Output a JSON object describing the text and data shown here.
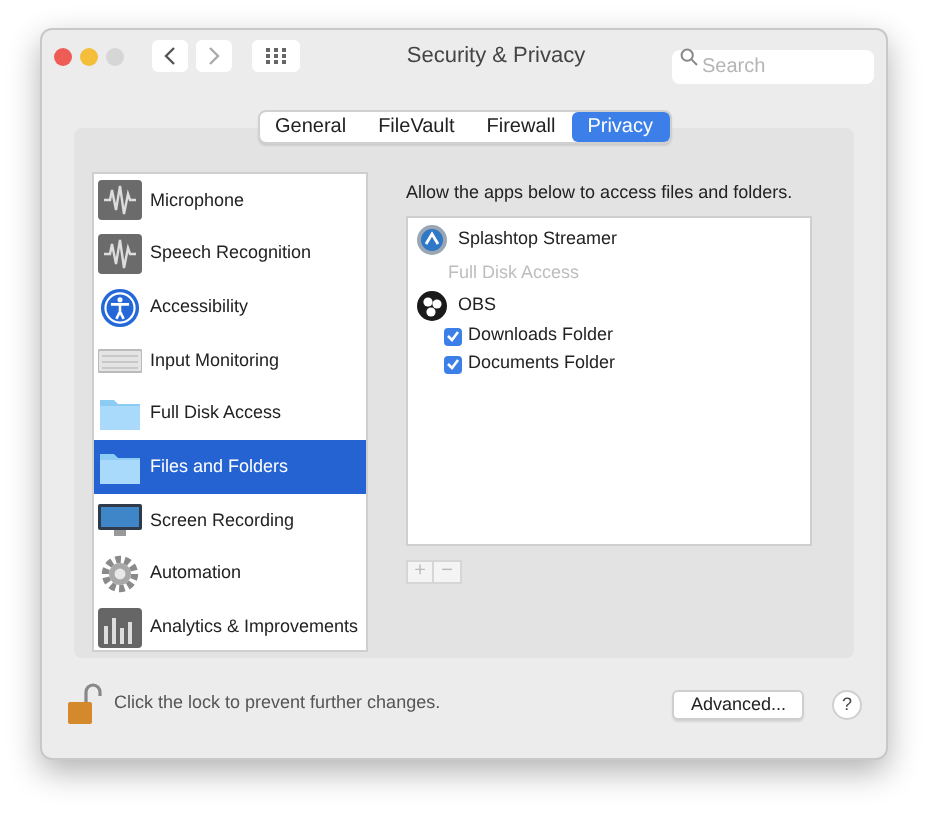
{
  "window": {
    "title": "Security & Privacy"
  },
  "search": {
    "placeholder": "Search"
  },
  "tabs": [
    {
      "label": "General",
      "selected": false
    },
    {
      "label": "FileVault",
      "selected": false
    },
    {
      "label": "Firewall",
      "selected": false
    },
    {
      "label": "Privacy",
      "selected": true
    }
  ],
  "sidebar": {
    "items": [
      {
        "label": "Microphone",
        "kind": "wave",
        "selected": false
      },
      {
        "label": "Speech Recognition",
        "kind": "wave",
        "selected": false
      },
      {
        "label": "Accessibility",
        "kind": "person",
        "selected": false
      },
      {
        "label": "Input Monitoring",
        "kind": "keyboard",
        "selected": false
      },
      {
        "label": "Full Disk Access",
        "kind": "folder",
        "selected": false
      },
      {
        "label": "Files and Folders",
        "kind": "folder",
        "selected": true
      },
      {
        "label": "Screen Recording",
        "kind": "monitor",
        "selected": false
      },
      {
        "label": "Automation",
        "kind": "gear",
        "selected": false
      },
      {
        "label": "Analytics & Improvements",
        "kind": "chart",
        "selected": false
      }
    ]
  },
  "detail": {
    "heading": "Allow the apps below to access files and folders.",
    "apps": [
      {
        "name": "Splashtop Streamer",
        "children": [
          {
            "label": "Full Disk Access",
            "kind": "note"
          }
        ]
      },
      {
        "name": "OBS",
        "children": [
          {
            "label": "Downloads Folder",
            "kind": "checkbox",
            "checked": true
          },
          {
            "label": "Documents Folder",
            "kind": "checkbox",
            "checked": true
          }
        ]
      }
    ],
    "add_button": "+",
    "remove_button": "−"
  },
  "footer": {
    "lock_text": "Click the lock to prevent further changes.",
    "advanced_button": "Advanced...",
    "help_button": "?"
  }
}
